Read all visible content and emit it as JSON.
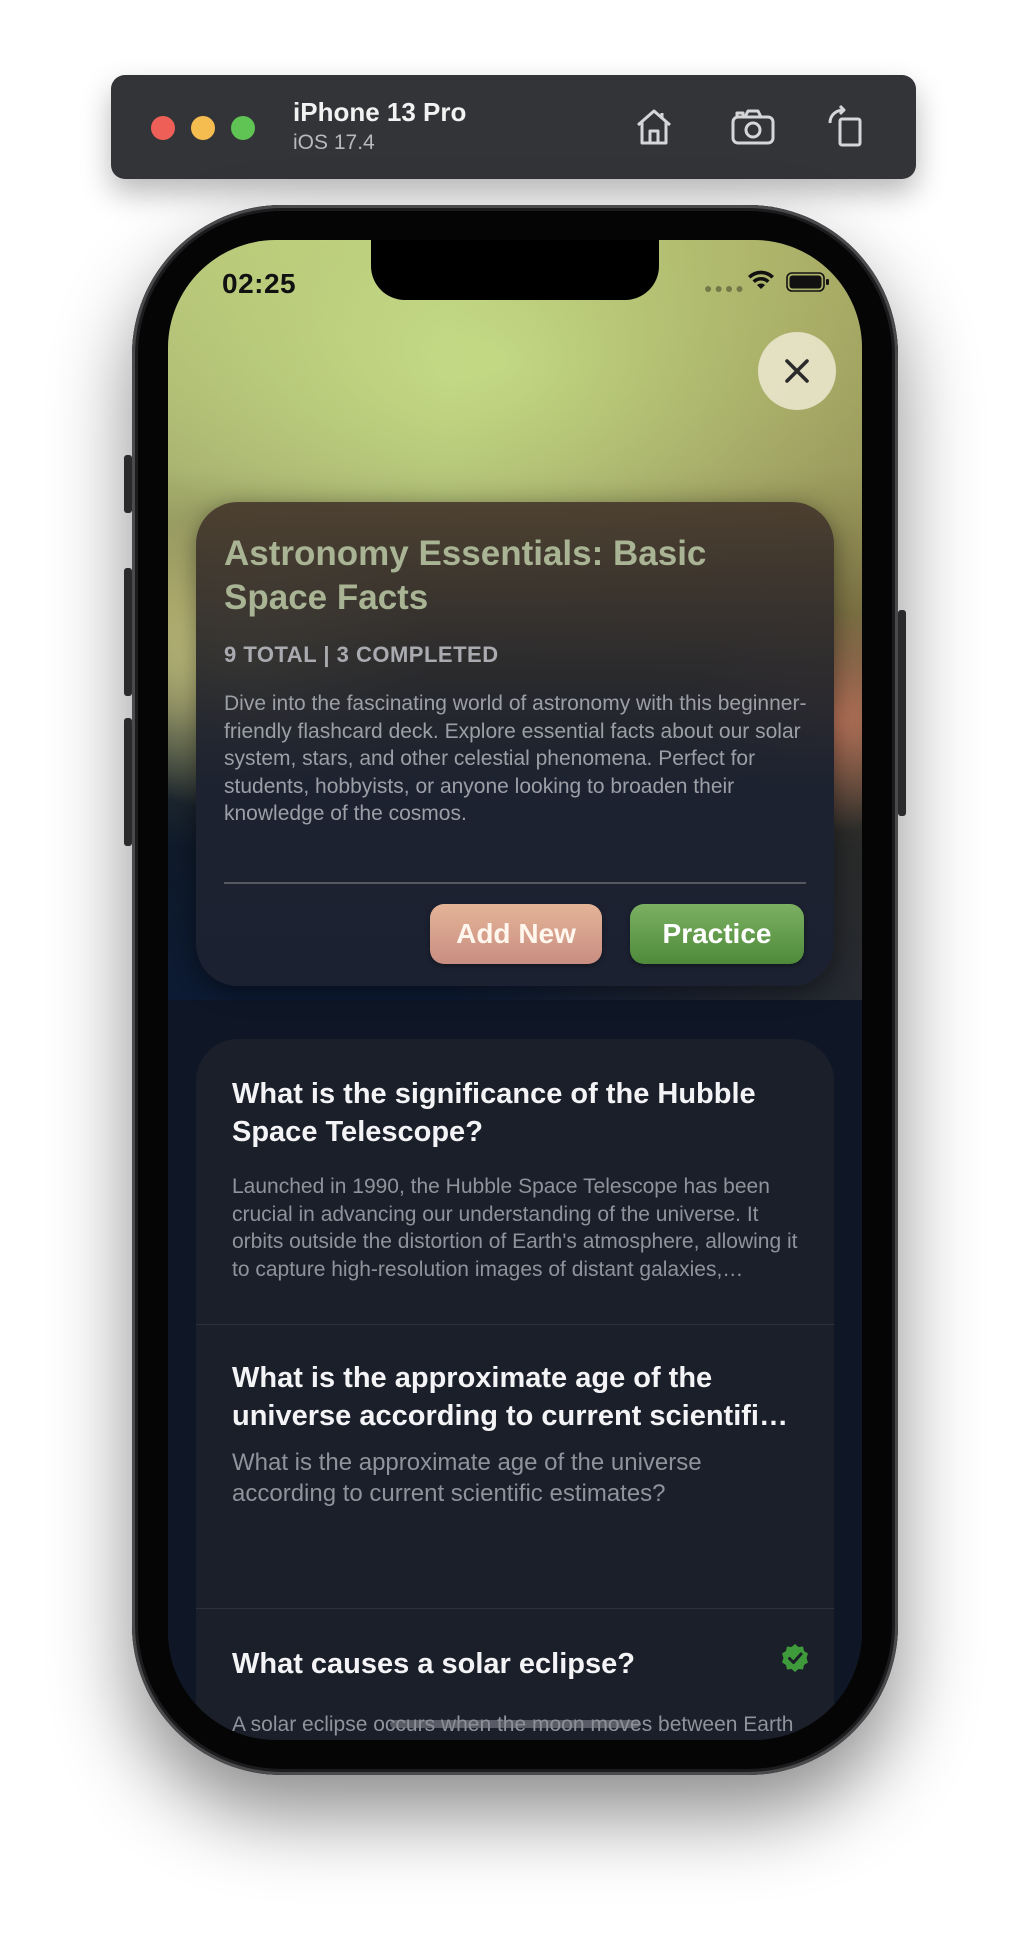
{
  "simulator": {
    "device_name": "iPhone 13 Pro",
    "os_version": "iOS 17.4",
    "toolbar_icons": [
      "home-icon",
      "screenshot-camera-icon",
      "rotate-icon"
    ]
  },
  "status_bar": {
    "time": "02:25",
    "icons": [
      "wifi-icon",
      "battery-icon"
    ]
  },
  "deck": {
    "title": "Astronomy Essentials: Basic Space Facts",
    "meta": "9 TOTAL | 3 COMPLETED",
    "description": "Dive into the fascinating world of astronomy with this beginner-friendly flashcard deck. Explore essential facts about our solar system, stars, and other celestial phenomena. Perfect for students, hobbyists, or anyone looking to broaden their knowledge of the cosmos.",
    "add_label": "Add New",
    "practice_label": "Practice",
    "add_color": "#d9a28c",
    "practice_color": "#5f9a4a"
  },
  "cards": [
    {
      "question": "What is the significance of the Hubble Space Telescope?",
      "answer": "Launched in 1990, the Hubble Space Telescope has been crucial in advancing our understanding of the universe. It orbits outside the distortion of Earth's atmosphere, allowing it to capture high-resolution images of distant galaxies, nebulae, and other celestial objects.",
      "completed": false
    },
    {
      "question": "What is the approximate age of the universe according to current scientific estimates?",
      "answer": "What is the approximate age of the universe according to current scientific estimates?",
      "completed": false
    },
    {
      "question": "What causes a solar eclipse?",
      "answer": "A solar eclipse occurs when the moon moves between Earth and the sun, blocking all or part of the sun's light.",
      "completed": true
    }
  ]
}
